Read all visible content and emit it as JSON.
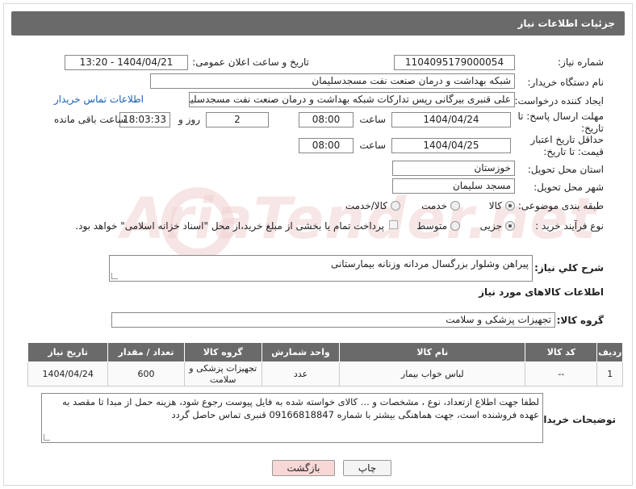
{
  "header": {
    "title": "جزئیات اطلاعات نیاز"
  },
  "fields": {
    "need_number_label": "شماره نیاز:",
    "need_number": "1104095179000054",
    "announce_label": "تاریخ و ساعت اعلان عمومی:",
    "announce_value": "1404/04/21 - 13:20",
    "buyer_org_label": "نام دستگاه خریدار:",
    "buyer_org": "شبکه بهداشت و درمان صنعت نفت مسجدسلیمان",
    "creator_label": "ایجاد کننده درخواست:",
    "creator": "علی قنبری بیرگانی رپس تدارکات شبکه بهداشت و درمان صنعت نفت مسجدسلیمان",
    "contact_link": "اطلاعات تماس خریدار",
    "reply_deadline_label": "مهلت ارسال پاسخ: تا تاریخ:",
    "reply_date": "1404/04/24",
    "time_label": "ساعت",
    "reply_time": "08:00",
    "days_value": "2",
    "days_label": "روز و",
    "remaining_time": "18:03:33",
    "remaining_label": "ساعت باقی مانده",
    "price_validity_label": "حداقل تاریخ اعتبار قیمت: تا تاریخ:",
    "price_date": "1404/04/25",
    "price_time": "08:00",
    "province_label": "استان محل تحویل:",
    "province": "خوزستان",
    "city_label": "شهر محل تحویل:",
    "city": "مسجد سلیمان",
    "category_label": "طبقه بندی موضوعی:",
    "category_options": [
      "کالا",
      "خدمت",
      "کالا/خدمت"
    ],
    "process_label": "نوع فرآیند خرید :",
    "process_options": [
      "جزیی",
      "متوسط"
    ],
    "payment_note": "پرداخت تمام یا بخشی از مبلغ خرید،از محل \"اسناد خزانه اسلامی\" خواهد بود."
  },
  "summary": {
    "label": "شرح کلي نياز:",
    "value": "پیراهن وشلوار بزرگسال مردانه وزنانه بیمارستانی"
  },
  "goods_section": {
    "title": "اطلاعات کالاهای مورد نیاز",
    "group_label": "گروه کالا:",
    "group_value": "تجهیزات پزشکی و سلامت"
  },
  "table": {
    "headers": [
      "ردیف",
      "کد کالا",
      "نام کالا",
      "واحد شمارش",
      "گروه کالا",
      "تعداد / مقدار",
      "تاریخ نیاز"
    ],
    "rows": [
      [
        "1",
        "--",
        "لباس خواب بیمار",
        "عدد",
        "تجهیزات پزشکی و سلامت",
        "600",
        "1404/04/24"
      ]
    ]
  },
  "buyer_notes": {
    "label": "توضیحات خریدار:",
    "value": "لطفا جهت اطلاع ازتعداد، نوع ، مشخصات و ... کالای خواسته شده به فایل پیوست رجوع شود، هزینه حمل از مبدا تا مقصد به عهده فروشنده است، جهت هماهنگی بیشتر با شماره 09166818847 قنبری تماس حاصل گردد"
  },
  "buttons": {
    "print": "چاپ",
    "back": "بازگشت"
  },
  "watermark": {
    "text": "AriaTender.net"
  },
  "colors": {
    "header_bg": "#6a6a6a",
    "link": "#1a5fb4",
    "back_btn": "#f8d7d7"
  }
}
